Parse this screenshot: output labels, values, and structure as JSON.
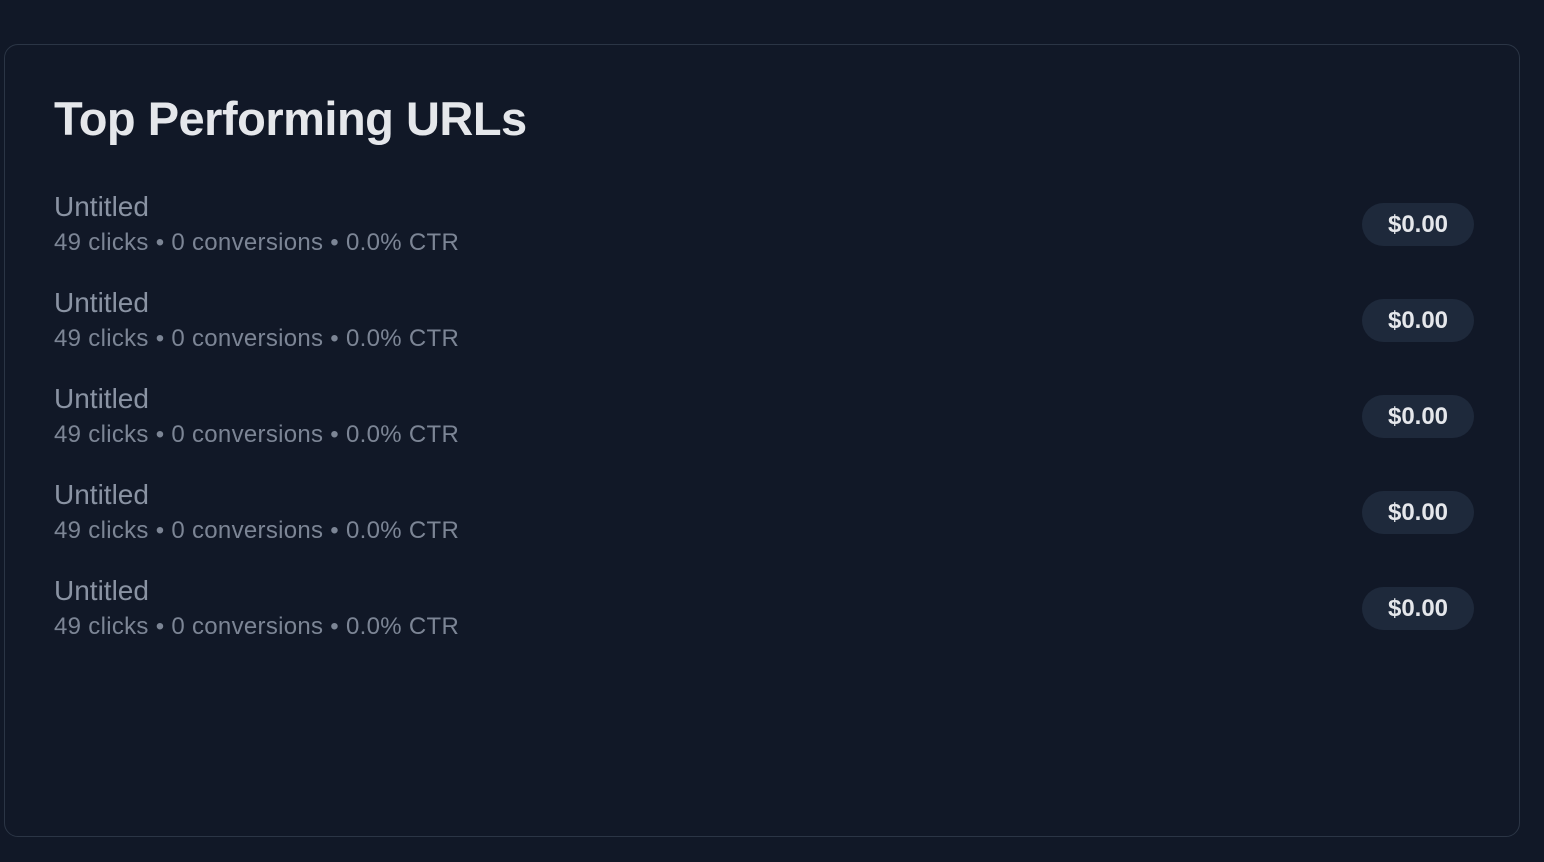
{
  "card": {
    "title": "Top Performing URLs"
  },
  "urls": [
    {
      "title": "Untitled",
      "meta": "49 clicks • 0 conversions • 0.0% CTR",
      "revenue": "$0.00"
    },
    {
      "title": "Untitled",
      "meta": "49 clicks • 0 conversions • 0.0% CTR",
      "revenue": "$0.00"
    },
    {
      "title": "Untitled",
      "meta": "49 clicks • 0 conversions • 0.0% CTR",
      "revenue": "$0.00"
    },
    {
      "title": "Untitled",
      "meta": "49 clicks • 0 conversions • 0.0% CTR",
      "revenue": "$0.00"
    },
    {
      "title": "Untitled",
      "meta": "49 clicks • 0 conversions • 0.0% CTR",
      "revenue": "$0.00"
    }
  ]
}
